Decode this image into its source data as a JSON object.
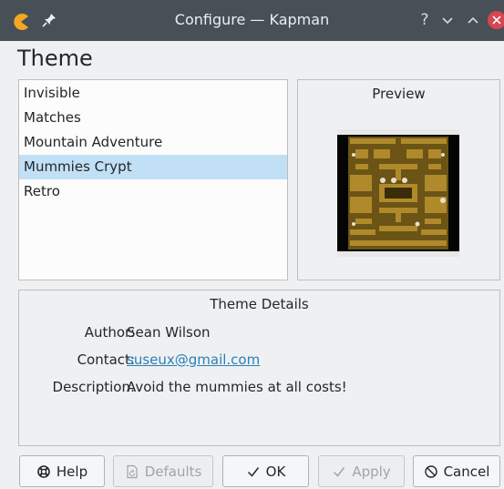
{
  "window": {
    "title": "Configure — Kapman",
    "help_glyph": "?",
    "icons": [
      "kapman-app-icon",
      "pin-icon",
      "help-icon",
      "minimize-icon",
      "maximize-icon",
      "close-icon"
    ]
  },
  "page": {
    "heading": "Theme"
  },
  "theme_list": {
    "items": [
      {
        "label": "Invisible",
        "selected": false
      },
      {
        "label": "Matches",
        "selected": false
      },
      {
        "label": "Mountain Adventure",
        "selected": false
      },
      {
        "label": "Mummies Crypt",
        "selected": true
      },
      {
        "label": "Retro",
        "selected": false
      }
    ]
  },
  "preview": {
    "title": "Preview"
  },
  "details": {
    "title": "Theme Details",
    "author_label": "Author:",
    "author": "Sean Wilson",
    "contact_label": "Contact:",
    "contact": "suseux@gmail.com",
    "description_label": "Description:",
    "description": "Avoid the mummies at all costs!"
  },
  "buttons": {
    "help": "Help",
    "defaults": "Defaults",
    "ok": "OK",
    "apply": "Apply",
    "cancel": "Cancel"
  },
  "colors": {
    "titlebar": "#475057",
    "selection": "#c2e0f5",
    "link": "#2980b9",
    "close": "#da4453",
    "app_icon": "#f6a623"
  }
}
